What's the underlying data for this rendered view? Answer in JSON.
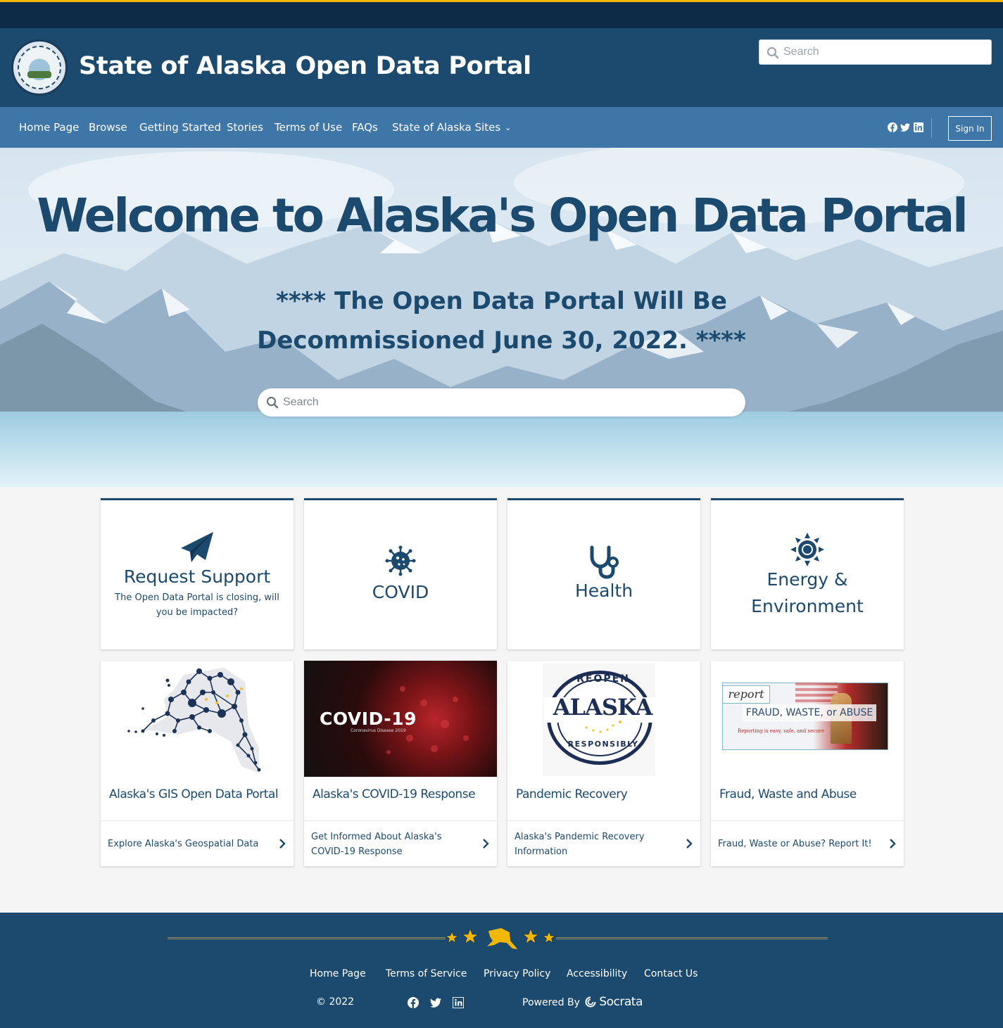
{
  "header": {
    "site_title": "State of Alaska Open Data Portal",
    "search_placeholder": "Search"
  },
  "nav": {
    "items": [
      {
        "label": "Home Page"
      },
      {
        "label": "Browse"
      },
      {
        "label": "Getting Started"
      },
      {
        "label": "Stories"
      },
      {
        "label": "Terms of Use"
      },
      {
        "label": "FAQs"
      },
      {
        "label": "State of Alaska Sites",
        "has_dropdown": true
      }
    ],
    "social_icons": [
      "facebook-icon",
      "twitter-icon",
      "linkedin-icon"
    ],
    "sign_in_label": "Sign In"
  },
  "hero": {
    "title": "Welcome to Alaska's Open Data Portal",
    "notice": "**** The Open Data Portal Will Be Decommissioned June 30, 2022. ****",
    "search_placeholder": "Search"
  },
  "categories": [
    {
      "icon": "paper-plane-icon",
      "label": "Request Support",
      "description": "The Open Data Portal is closing, will you be impacted?"
    },
    {
      "icon": "virus-icon",
      "label": "COVID"
    },
    {
      "icon": "stethoscope-icon",
      "label": "Health"
    },
    {
      "icon": "sun-icon",
      "label": "Energy & Environment"
    }
  ],
  "cards": [
    {
      "title": "Alaska's GIS Open Data Portal",
      "link": "Explore Alaska's Geospatial Data",
      "image": "alaska-network-map-image"
    },
    {
      "title": "Alaska's COVID-19 Response",
      "link": "Get Informed About Alaska's COVID-19 Response",
      "image": "covid-19-virus-image",
      "image_text": {
        "main": "COVID-19",
        "sub": "Coronavirus Disease 2019"
      }
    },
    {
      "title": "Pandemic Recovery",
      "link": "Alaska's Pandemic Recovery Information",
      "image": "reopen-alaska-badge-image",
      "image_text": {
        "top": "REOPEN",
        "main": "ALASKA",
        "bottom": "RESPONSIBLY"
      }
    },
    {
      "title": "Fraud, Waste and Abuse",
      "link": "Fraud, Waste or Abuse? Report It!",
      "image": "report-fraud-banner-image",
      "image_text": {
        "tag": "report",
        "main": "FRAUD, WASTE, or ABUSE",
        "sub": "Reporting is easy, safe, and secure"
      }
    }
  ],
  "footer": {
    "links": [
      {
        "label": "Home Page"
      },
      {
        "label": "Terms of Service"
      },
      {
        "label": "Privacy Policy"
      },
      {
        "label": "Accessibility"
      },
      {
        "label": "Contact Us"
      }
    ],
    "copyright": "© 2022",
    "social_icons": [
      "facebook-icon",
      "twitter-icon",
      "linkedin-icon"
    ],
    "powered_by": "Powered By",
    "brand": "Socrata"
  },
  "colors": {
    "topbar": "#0d2b47",
    "accent_gold": "#f2b705",
    "header": "#1c4a6e",
    "nav": "#3f76a8",
    "text_dark_blue": "#1b4a6e"
  }
}
